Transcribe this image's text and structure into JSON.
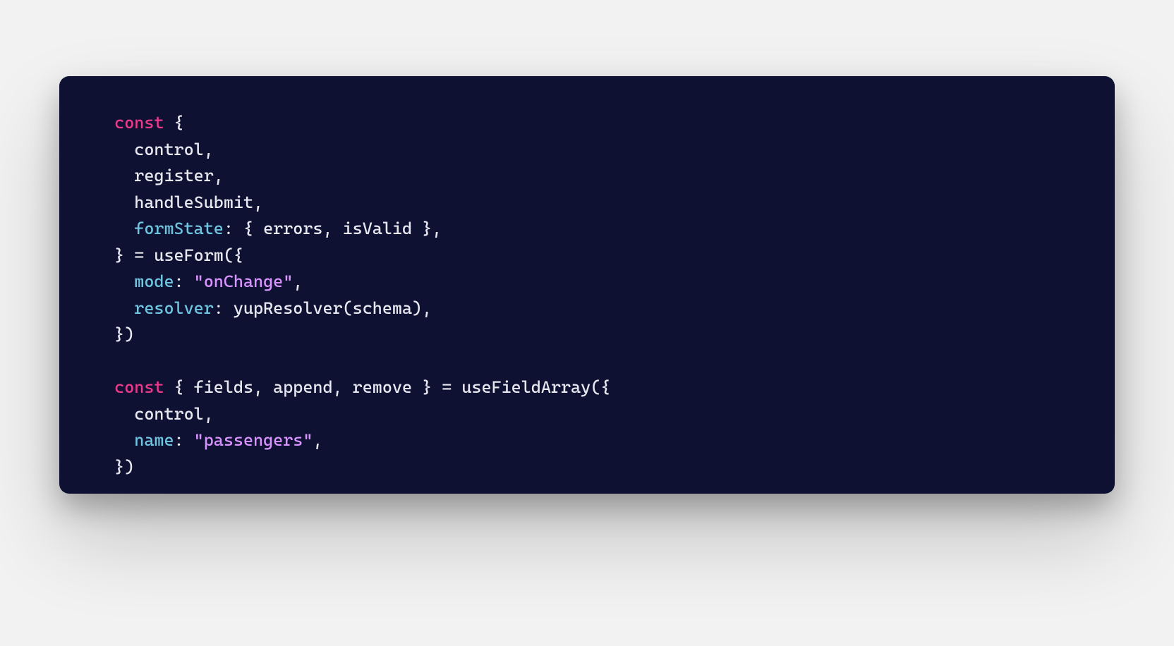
{
  "colors": {
    "background": "#f2f2f2",
    "card": "#0f1133",
    "text": "#e8e8f0",
    "keyword": "#ec3a8b",
    "property": "#6fc5df",
    "string": "#d994ff"
  },
  "code": {
    "kw_const1": "const",
    "brace_open1": " {",
    "l_control": "    control,",
    "l_register": "    register,",
    "l_handleSubmit": "    handleSubmit,",
    "prop_formState": "formState",
    "fs_colon": ":",
    "fs_open": " { ",
    "fs_errors": "errors",
    "fs_sep": ", ",
    "fs_isValid": "isValid",
    "fs_close": " },",
    "close_eq": "  } = ",
    "fn_useForm": "useForm",
    "useForm_open": "({",
    "prop_mode": "mode",
    "mode_colon": ": ",
    "str_onChange": "\"onChange\"",
    "mode_comma": ",",
    "prop_resolver": "resolver",
    "resolver_colon": ": ",
    "fn_yupResolver": "yupResolver",
    "yup_open": "(",
    "arg_schema": "schema",
    "yup_close": "),",
    "useForm_close": "  })",
    "blank": "",
    "kw_const2": "const",
    "arr_open": " { ",
    "arr_fields": "fields",
    "arr_sep1": ", ",
    "arr_append": "append",
    "arr_sep2": ", ",
    "arr_remove": "remove",
    "arr_close": " } = ",
    "fn_useFieldArray": "useFieldArray",
    "ufa_open": "({",
    "l_control2": "    control,",
    "prop_name": "name",
    "name_colon": ": ",
    "str_passengers": "\"passengers\"",
    "name_comma": ",",
    "ufa_close": "  })"
  }
}
